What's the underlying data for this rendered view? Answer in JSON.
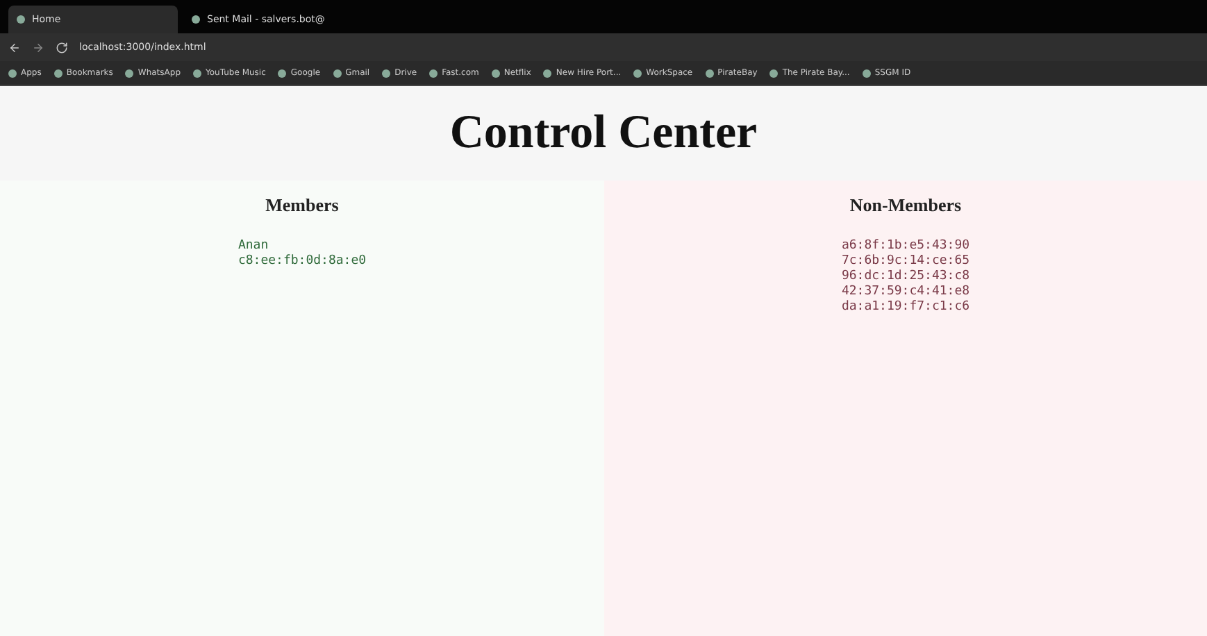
{
  "browser": {
    "tabs": [
      {
        "label": "Home",
        "selected": true
      },
      {
        "label": "Sent Mail - salvers.bot@",
        "selected": false
      }
    ],
    "address": "localhost:3000/index.html",
    "bookmarks": [
      "Apps",
      "Bookmarks",
      "WhatsApp",
      "YouTube Music",
      "Google",
      "Gmail",
      "Drive",
      "Fast.com",
      "Netflix",
      "New Hire Port...",
      "WorkSpace",
      "PirateBay",
      "The Pirate Bay...",
      "SSGM ID"
    ]
  },
  "page": {
    "title": "Control Center",
    "members": {
      "heading": "Members",
      "entries": [
        {
          "name": "Anan",
          "mac": "c8:ee:fb:0d:8a:e0"
        }
      ]
    },
    "non_members": {
      "heading": "Non-Members",
      "macs": [
        "a6:8f:1b:e5:43:90",
        "7c:6b:9c:14:ce:65",
        "96:dc:1d:25:43:c8",
        "42:37:59:c4:41:e8",
        "da:a1:19:f7:c1:c6"
      ]
    }
  }
}
